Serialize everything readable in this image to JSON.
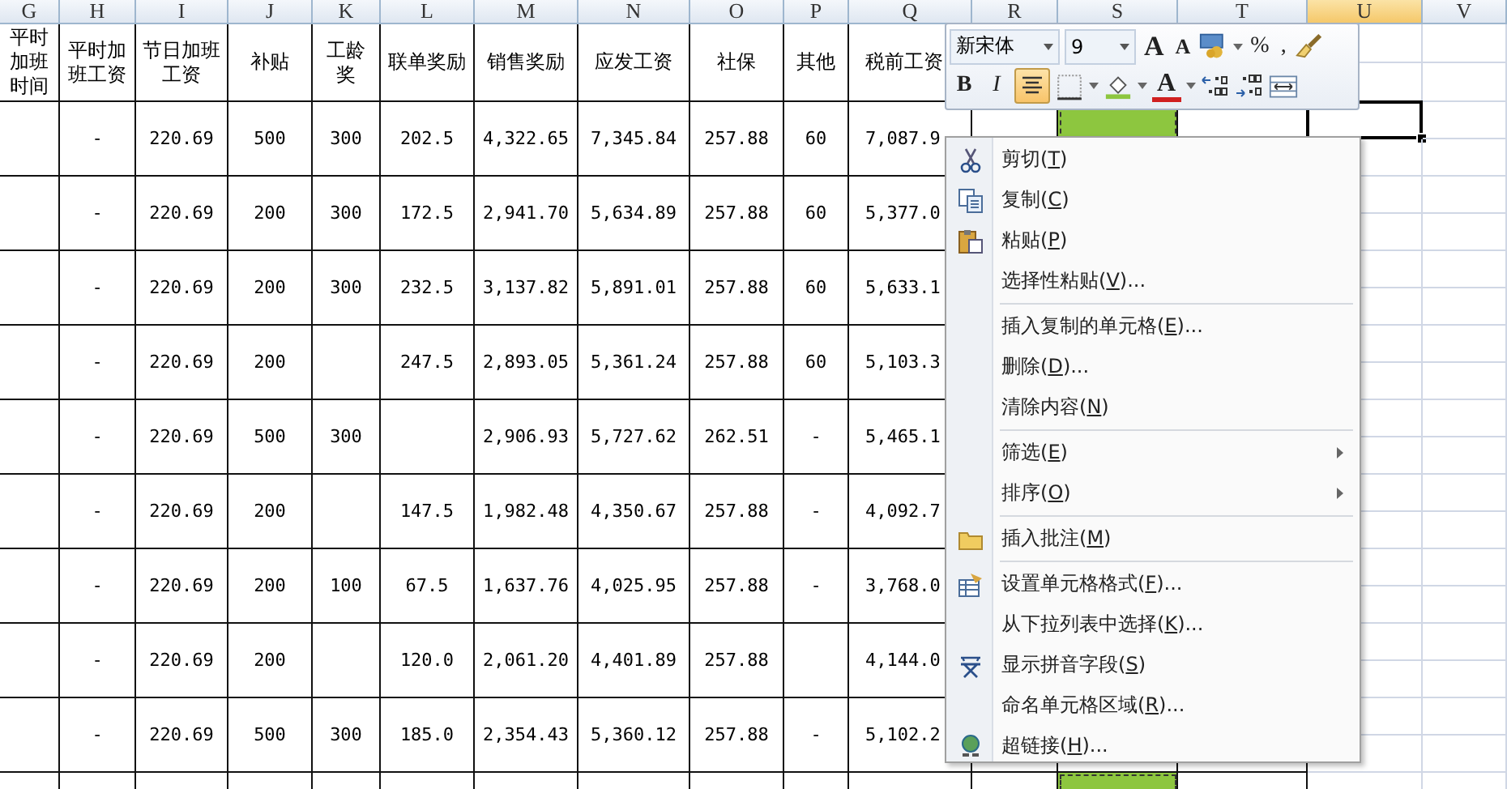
{
  "columns": [
    {
      "letter": "G",
      "selected": false
    },
    {
      "letter": "H",
      "selected": false
    },
    {
      "letter": "I",
      "selected": false
    },
    {
      "letter": "J",
      "selected": false
    },
    {
      "letter": "K",
      "selected": false
    },
    {
      "letter": "L",
      "selected": false
    },
    {
      "letter": "M",
      "selected": false
    },
    {
      "letter": "N",
      "selected": false
    },
    {
      "letter": "O",
      "selected": false
    },
    {
      "letter": "P",
      "selected": false
    },
    {
      "letter": "Q",
      "selected": false
    },
    {
      "letter": "R",
      "selected": false
    },
    {
      "letter": "S",
      "selected": false
    },
    {
      "letter": "T",
      "selected": false
    },
    {
      "letter": "U",
      "selected": true
    },
    {
      "letter": "V",
      "selected": false
    }
  ],
  "header_labels": [
    "平时加班时间",
    "平时加班工资",
    "节日加班工资",
    "补贴",
    "工龄奖",
    "联单奖励",
    "销售奖励",
    "应发工资",
    "社保",
    "其他",
    "税前工资"
  ],
  "rows": [
    {
      "cells": [
        null,
        "-",
        "220.69",
        "500",
        "300",
        "202.5",
        "4,322.65",
        "7,345.84",
        "257.88",
        "60",
        "7,087.9"
      ]
    },
    {
      "cells": [
        null,
        "-",
        "220.69",
        "200",
        "300",
        "172.5",
        "2,941.70",
        "5,634.89",
        "257.88",
        "60",
        "5,377.0"
      ]
    },
    {
      "cells": [
        null,
        "-",
        "220.69",
        "200",
        "300",
        "232.5",
        "3,137.82",
        "5,891.01",
        "257.88",
        "60",
        "5,633.1"
      ]
    },
    {
      "cells": [
        null,
        "-",
        "220.69",
        "200",
        null,
        "247.5",
        "2,893.05",
        "5,361.24",
        "257.88",
        "60",
        "5,103.3"
      ]
    },
    {
      "cells": [
        null,
        "-",
        "220.69",
        "500",
        "300",
        null,
        "2,906.93",
        "5,727.62",
        "262.51",
        "-",
        "5,465.1"
      ]
    },
    {
      "cells": [
        null,
        "-",
        "220.69",
        "200",
        null,
        "147.5",
        "1,982.48",
        "4,350.67",
        "257.88",
        "-",
        "4,092.7"
      ]
    },
    {
      "cells": [
        null,
        "-",
        "220.69",
        "200",
        "100",
        "67.5",
        "1,637.76",
        "4,025.95",
        "257.88",
        "-",
        "3,768.0"
      ]
    },
    {
      "cells": [
        null,
        "-",
        "220.69",
        "200",
        null,
        "120.0",
        "2,061.20",
        "4,401.89",
        "257.88",
        null,
        "4,144.0"
      ]
    },
    {
      "cells": [
        null,
        "-",
        "220.69",
        "500",
        "300",
        "185.0",
        "2,354.43",
        "5,360.12",
        "257.88",
        "-",
        "5,102.2"
      ]
    }
  ],
  "copy_marquee": {
    "top": true,
    "bottom": true
  },
  "toolbar": {
    "font": "新宋体",
    "size": "9",
    "grow_font": "A",
    "shrink_font": "A",
    "percent": "%",
    "comma": ",",
    "bold": "B",
    "italic": "I",
    "center_pressed": true,
    "font_color": "A"
  },
  "menu": [
    {
      "kind": "item",
      "before": "剪切(",
      "key": "T",
      "after": ")",
      "submenu": false
    },
    {
      "kind": "item",
      "before": "复制(",
      "key": "C",
      "after": ")",
      "submenu": false
    },
    {
      "kind": "item",
      "before": "粘贴(",
      "key": "P",
      "after": ")",
      "submenu": false
    },
    {
      "kind": "item",
      "before": "选择性粘贴(",
      "key": "V",
      "after": ")...",
      "submenu": false
    },
    {
      "kind": "separator"
    },
    {
      "kind": "item",
      "before": "插入复制的单元格(",
      "key": "E",
      "after": ")...",
      "submenu": false
    },
    {
      "kind": "item",
      "before": "删除(",
      "key": "D",
      "after": ")...",
      "submenu": false
    },
    {
      "kind": "item",
      "before": "清除内容(",
      "key": "N",
      "after": ")",
      "submenu": false
    },
    {
      "kind": "separator"
    },
    {
      "kind": "item",
      "before": "筛选(",
      "key": "E",
      "after": ")",
      "submenu": true
    },
    {
      "kind": "item",
      "before": "排序(",
      "key": "O",
      "after": ")",
      "submenu": true
    },
    {
      "kind": "separator"
    },
    {
      "kind": "item",
      "before": "插入批注(",
      "key": "M",
      "after": ")",
      "submenu": false
    },
    {
      "kind": "separator"
    },
    {
      "kind": "item",
      "before": "设置单元格格式(",
      "key": "F",
      "after": ")...",
      "submenu": false
    },
    {
      "kind": "item",
      "before": "从下拉列表中选择(",
      "key": "K",
      "after": ")...",
      "submenu": false
    },
    {
      "kind": "item",
      "before": "显示拼音字段(",
      "key": "S",
      "after": ")",
      "submenu": false
    },
    {
      "kind": "item",
      "before": "命名单元格区域(",
      "key": "R",
      "after": ")...",
      "submenu": false
    },
    {
      "kind": "item",
      "before": "超链接(",
      "key": "H",
      "after": ")...",
      "submenu": false
    }
  ]
}
